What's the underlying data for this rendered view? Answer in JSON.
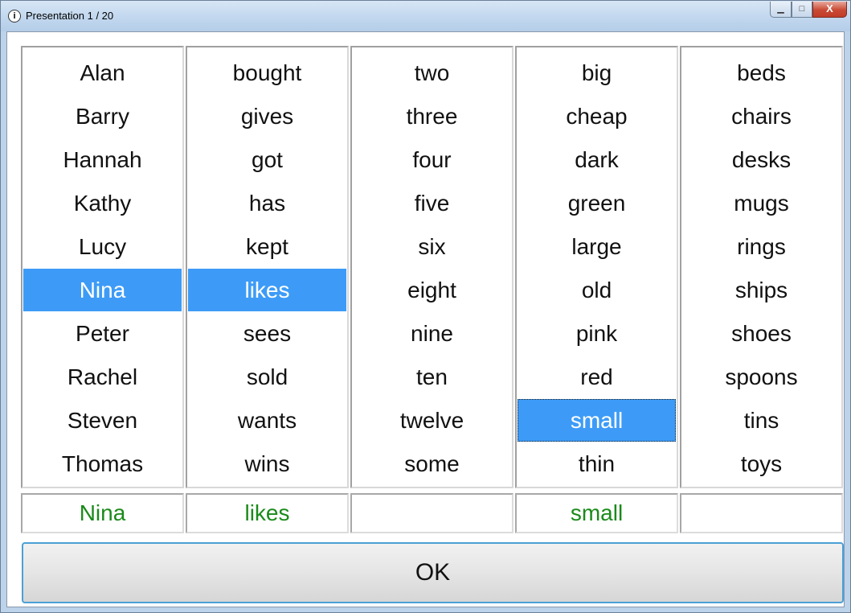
{
  "window": {
    "title": "Presentation 1 / 20",
    "controls": {
      "minimize": "▁",
      "maximize": "□",
      "close": "X"
    }
  },
  "columns": [
    {
      "items": [
        "Alan",
        "Barry",
        "Hannah",
        "Kathy",
        "Lucy",
        "Nina",
        "Peter",
        "Rachel",
        "Steven",
        "Thomas"
      ],
      "selected": "Nina"
    },
    {
      "items": [
        "bought",
        "gives",
        "got",
        "has",
        "kept",
        "likes",
        "sees",
        "sold",
        "wants",
        "wins"
      ],
      "selected": "likes"
    },
    {
      "items": [
        "two",
        "three",
        "four",
        "five",
        "six",
        "eight",
        "nine",
        "ten",
        "twelve",
        "some"
      ],
      "selected": ""
    },
    {
      "items": [
        "big",
        "cheap",
        "dark",
        "green",
        "large",
        "old",
        "pink",
        "red",
        "small",
        "thin"
      ],
      "selected": "small"
    },
    {
      "items": [
        "beds",
        "chairs",
        "desks",
        "mugs",
        "rings",
        "ships",
        "shoes",
        "spoons",
        "tins",
        "toys"
      ],
      "selected": ""
    }
  ],
  "results": [
    "Nina",
    "likes",
    "",
    "small",
    ""
  ],
  "ok_button": "OK",
  "colors": {
    "selection": "#3d9bf7",
    "result_text": "#1a8a1a",
    "focus_border": "#4ba0d6"
  }
}
